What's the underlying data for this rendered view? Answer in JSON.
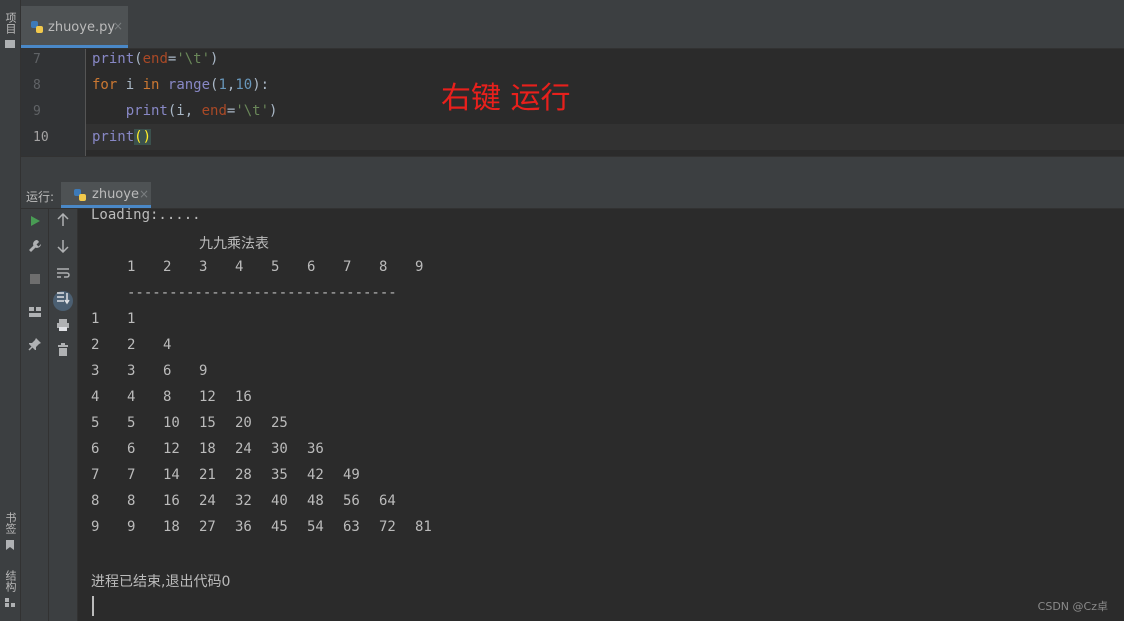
{
  "sidebar": {
    "top_label": "项目",
    "bookmarks_label": "书签",
    "structure_label": "结构"
  },
  "editor_tab": {
    "filename": "zhuoye.py",
    "close": "×"
  },
  "editor": {
    "line_numbers": [
      "7",
      "8",
      "9",
      "10"
    ],
    "annotation": "右键 运行"
  },
  "run_panel": {
    "label": "运行:",
    "tab_name": "zhuoye",
    "close": "×"
  },
  "console": {
    "loading": "Loading:.....",
    "table_title": "九九乘法表",
    "header_numbers": [
      "1",
      "2",
      "3",
      "4",
      "5",
      "6",
      "7",
      "8",
      "9"
    ],
    "divider": "--------------------------------",
    "rows": [
      [
        "1",
        "1"
      ],
      [
        "2",
        "2",
        "4"
      ],
      [
        "3",
        "3",
        "6",
        "9"
      ],
      [
        "4",
        "4",
        "8",
        "12",
        "16"
      ],
      [
        "5",
        "5",
        "10",
        "15",
        "20",
        "25"
      ],
      [
        "6",
        "6",
        "12",
        "18",
        "24",
        "30",
        "36"
      ],
      [
        "7",
        "7",
        "14",
        "21",
        "28",
        "35",
        "42",
        "49"
      ],
      [
        "8",
        "8",
        "16",
        "24",
        "32",
        "40",
        "48",
        "56",
        "64"
      ],
      [
        "9",
        "9",
        "18",
        "27",
        "36",
        "45",
        "54",
        "63",
        "72",
        "81"
      ]
    ],
    "exit_message": "进程已结束,退出代码0"
  },
  "watermark": "CSDN @Cz卓",
  "icons": {
    "run": "play-icon",
    "wrench": "wrench-icon",
    "stop": "stop-icon",
    "layout": "layout-icon",
    "pin": "pin-icon",
    "up": "arrow-up-icon",
    "down": "arrow-down-icon",
    "wrap": "soft-wrap-icon",
    "scroll_end": "scroll-to-end-icon",
    "print": "print-icon",
    "trash": "trash-icon"
  },
  "colors": {
    "accent": "#4a88c7",
    "annotation": "#e8201c",
    "keyword": "#cc7832",
    "string": "#6a8759"
  }
}
